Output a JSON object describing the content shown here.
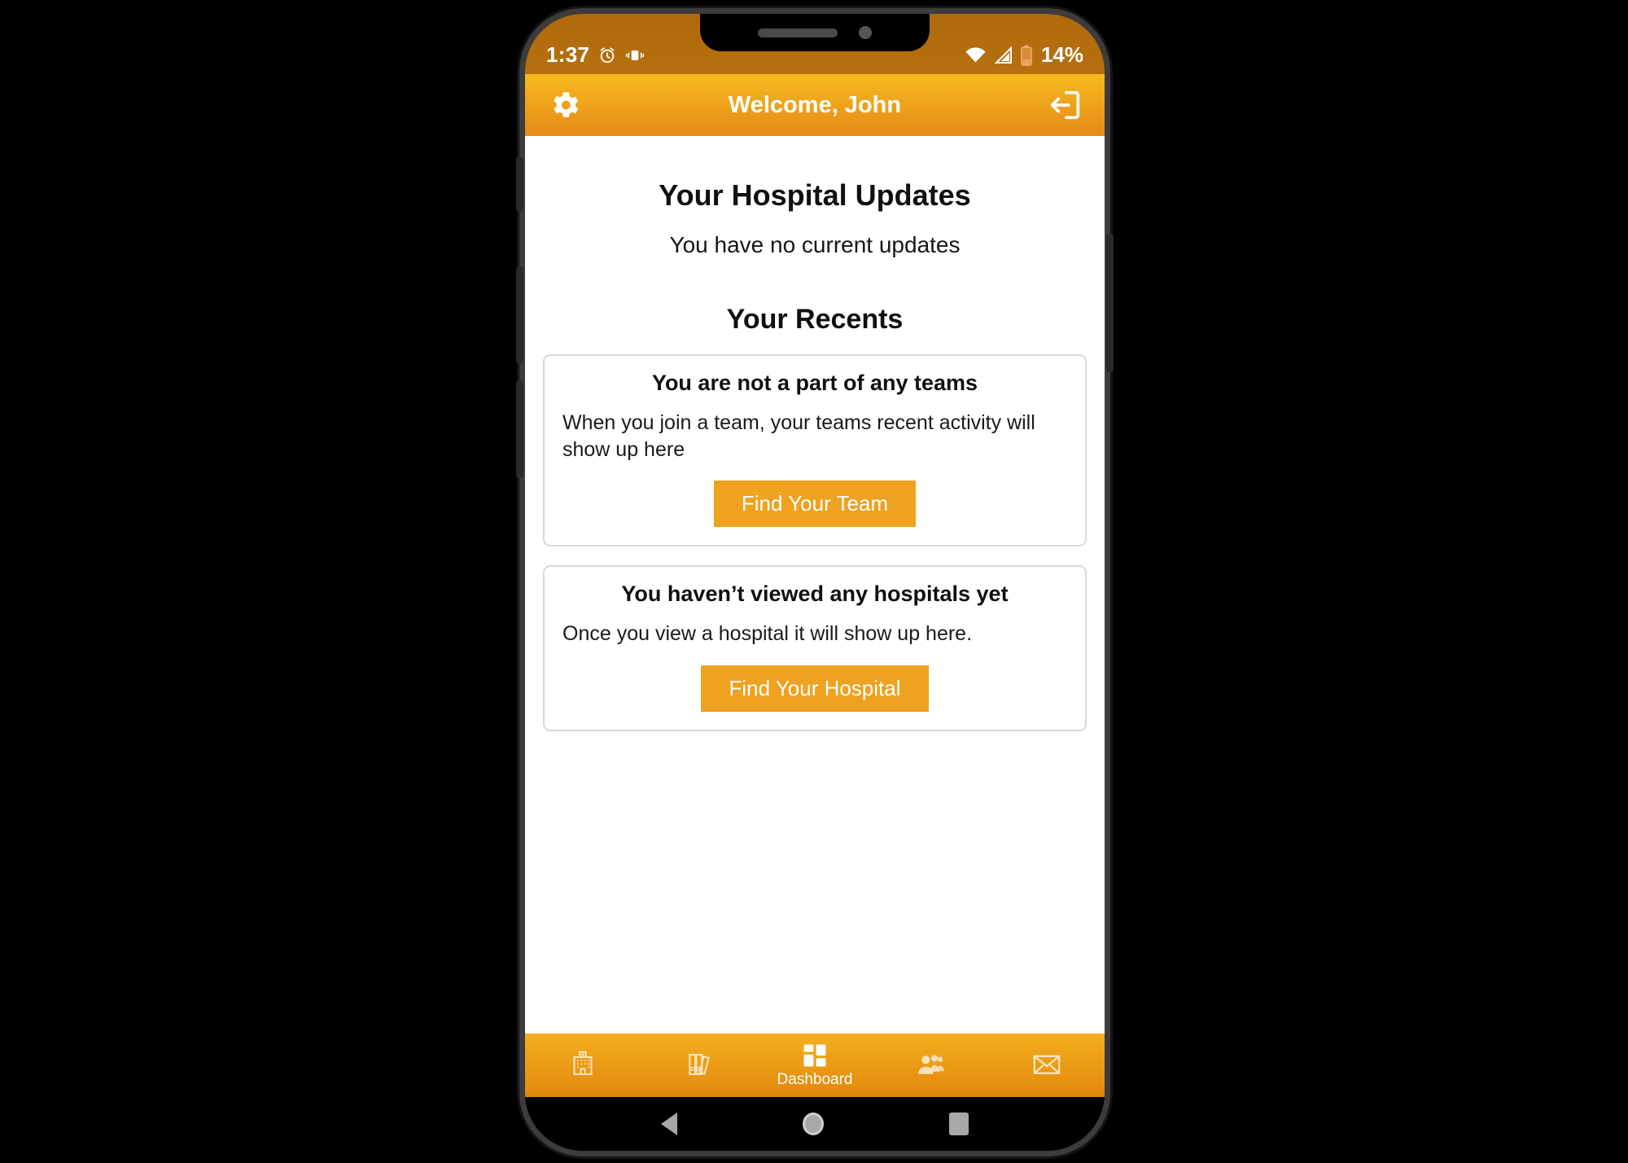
{
  "status_bar": {
    "time": "1:37",
    "battery_percent": "14%",
    "icons_left": [
      "alarm-icon",
      "vibrate-icon"
    ],
    "icons_right": [
      "wifi-icon",
      "cell-signal-icon",
      "battery-icon"
    ]
  },
  "header": {
    "title": "Welcome, John",
    "settings_icon": "gear-icon",
    "logout_icon": "logout-icon",
    "gradient_top": "#f7bb1e",
    "gradient_bottom": "#e58a18"
  },
  "main": {
    "updates_title": "Your Hospital Updates",
    "updates_empty": "You have no current updates",
    "recents_title": "Your Recents",
    "cards": [
      {
        "title": "You are not a part of any teams",
        "text": "When you join a team, your teams recent activity will show up here",
        "button_label": "Find Your Team"
      },
      {
        "title": "You haven’t viewed any hospitals yet",
        "text": "Once you view a hospital it will show up here.",
        "button_label": "Find Your Hospital"
      }
    ],
    "button_color": "#efa21f"
  },
  "bottom_nav": {
    "items": [
      {
        "icon": "hospital-icon",
        "label": "",
        "active": false
      },
      {
        "icon": "books-icon",
        "label": "",
        "active": false
      },
      {
        "icon": "dashboard-icon",
        "label": "Dashboard",
        "active": true
      },
      {
        "icon": "people-icon",
        "label": "",
        "active": false
      },
      {
        "icon": "envelope-icon",
        "label": "",
        "active": false
      }
    ]
  },
  "android_nav": {
    "back": "back-triangle-icon",
    "home": "home-circle-icon",
    "recents": "recents-square-icon"
  }
}
